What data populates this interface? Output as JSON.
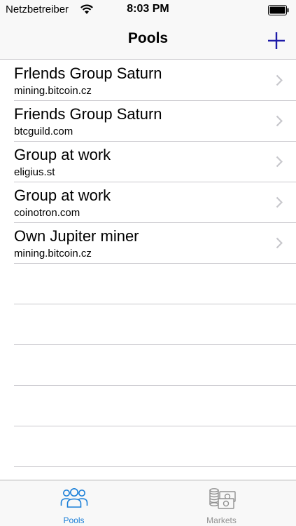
{
  "status_bar": {
    "carrier": "Netzbetreiber",
    "time": "8:03 PM"
  },
  "nav": {
    "title": "Pools"
  },
  "pools": [
    {
      "name": "Frlends Group Saturn",
      "host": "mining.bitcoin.cz"
    },
    {
      "name": "Friends Group Saturn",
      "host": "btcguild.com"
    },
    {
      "name": "Group at work",
      "host": "eligius.st"
    },
    {
      "name": "Group at work",
      "host": "coinotron.com"
    },
    {
      "name": "Own Jupiter miner",
      "host": "mining.bitcoin.cz"
    }
  ],
  "tabs": [
    {
      "label": "Pools",
      "icon": "group-icon",
      "selected": true
    },
    {
      "label": "Markets",
      "icon": "money-icon",
      "selected": false
    }
  ],
  "colors": {
    "accent": "#1a7fd8",
    "nav_plus": "#1d1aa8",
    "tab_inactive": "#929292",
    "separator": "#c8c7cc",
    "chevron": "#c7c7cc"
  }
}
